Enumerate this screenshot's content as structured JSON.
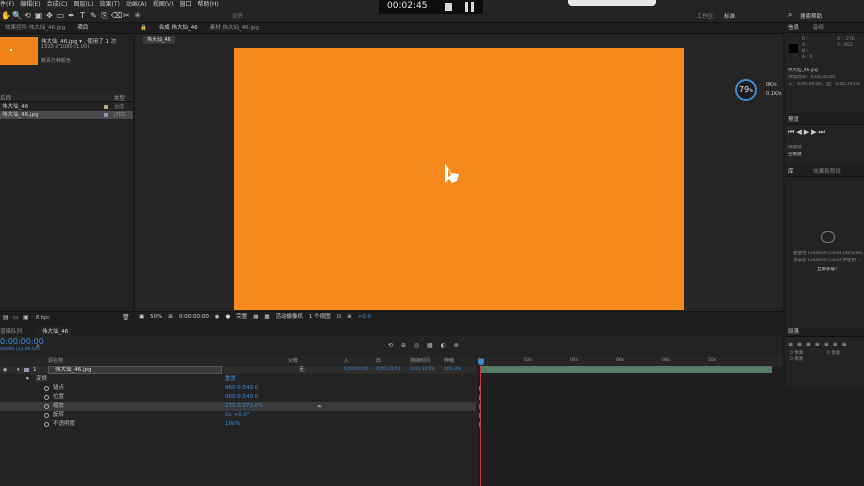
{
  "menubar": {
    "items": [
      "件(F)",
      "编辑(E)",
      "合成(C)",
      "图层(L)",
      "效果(T)",
      "动画(A)",
      "视图(V)",
      "窗口",
      "帮助(H)"
    ]
  },
  "toolbar": {
    "snap_label": "对齐",
    "workspace_label": "工作区:",
    "workspace_value": "标准",
    "search_label": "搜索帮助",
    "tools": [
      "hand-icon",
      "zoom-icon",
      "rotate-icon",
      "camera-icon",
      "pan-behind-icon",
      "rect-mask-icon",
      "pen-icon",
      "type-icon",
      "brush-icon",
      "clone-icon",
      "eraser-icon",
      "roto-icon",
      "pin-icon"
    ]
  },
  "recorder": {
    "time": "00:02:45"
  },
  "project": {
    "tab1": "效果控件 伟大仙_46.jpg",
    "tab2": "项目",
    "file_name": "伟大仙_46.jpg",
    "used_count": "▾ , 使用了 1 次",
    "resolution": "1920 x 1080 (1.00)",
    "color_info": "数百万种颜色",
    "col_name": "名称",
    "col_type": "类型",
    "items": [
      {
        "name": "伟大仙_46",
        "type": "合成"
      },
      {
        "name": "伟大仙_46.jpg",
        "type": "JPEG"
      }
    ],
    "bpc": "8 bpc"
  },
  "viewer": {
    "tab_comp": "合成 伟大仙_46",
    "tab_footage": "素材 伟大仙_46.jpg",
    "subtab": "伟大仙_46",
    "zoom": "50%",
    "timecode": "0:00:00:00",
    "quality": "完整",
    "camera": "活动摄像机",
    "views": "1 个视图",
    "exposure": "+0.0"
  },
  "gauge": {
    "value": "79",
    "unit": "%",
    "up": "0K/s",
    "down": "0.1K/s"
  },
  "info_panel": {
    "tab_info": "信息",
    "tab_audio": "音频",
    "rgb": [
      "R :",
      "G :",
      "B :",
      "A : 0"
    ],
    "xy": [
      "X : -276",
      "Y : 852"
    ],
    "clip_name": "伟大仙_46.jpg",
    "duration": "持续时间：0;00;30;00",
    "in_out": "入：0;00;00;00，出：0;00;30;03"
  },
  "preview_panel": {
    "title": "预览",
    "shortcut_label": "快捷键",
    "shortcut_value": "空格键"
  },
  "library_panel": {
    "tab1": "库",
    "tab2": "效果和预设",
    "message1": "要使用 Creative Cloud Libraries,",
    "message2": "请安装 Creative Cloud 并使用 ...",
    "retry": "立即获取！"
  },
  "paragraph_panel": {
    "title": "段落",
    "values": [
      "0 像素",
      "0 像素",
      "0 像素"
    ]
  },
  "timeline": {
    "tab_render": "渲染队列",
    "tab_comp": "伟大仙_46",
    "time": "0:00:00:00",
    "fps_note": "00000 (25.00 fps)",
    "columns": [
      "源名称",
      "父级",
      "入",
      "出",
      "持续时间",
      "伸缩"
    ],
    "layer": {
      "index": "1",
      "name": "伟大仙_46.jpg",
      "parent": "无",
      "in": "0;00;00;00",
      "out": "0;00;29;02",
      "duration": "0;00;30;04",
      "stretch": "100.0%"
    },
    "transform_label": "变换",
    "reset_label": "重置",
    "properties": [
      {
        "name": "锚点",
        "value": "960.0,540.0"
      },
      {
        "name": "位置",
        "value": "960.0,540.0"
      },
      {
        "name": "缩放",
        "value": "271.0,271.0%"
      },
      {
        "name": "旋转",
        "value": "0x +0.0°"
      },
      {
        "name": "不透明度",
        "value": "100%"
      }
    ],
    "ruler": [
      "0s",
      "02s",
      "04s",
      "06s",
      "08s",
      "10s"
    ]
  }
}
